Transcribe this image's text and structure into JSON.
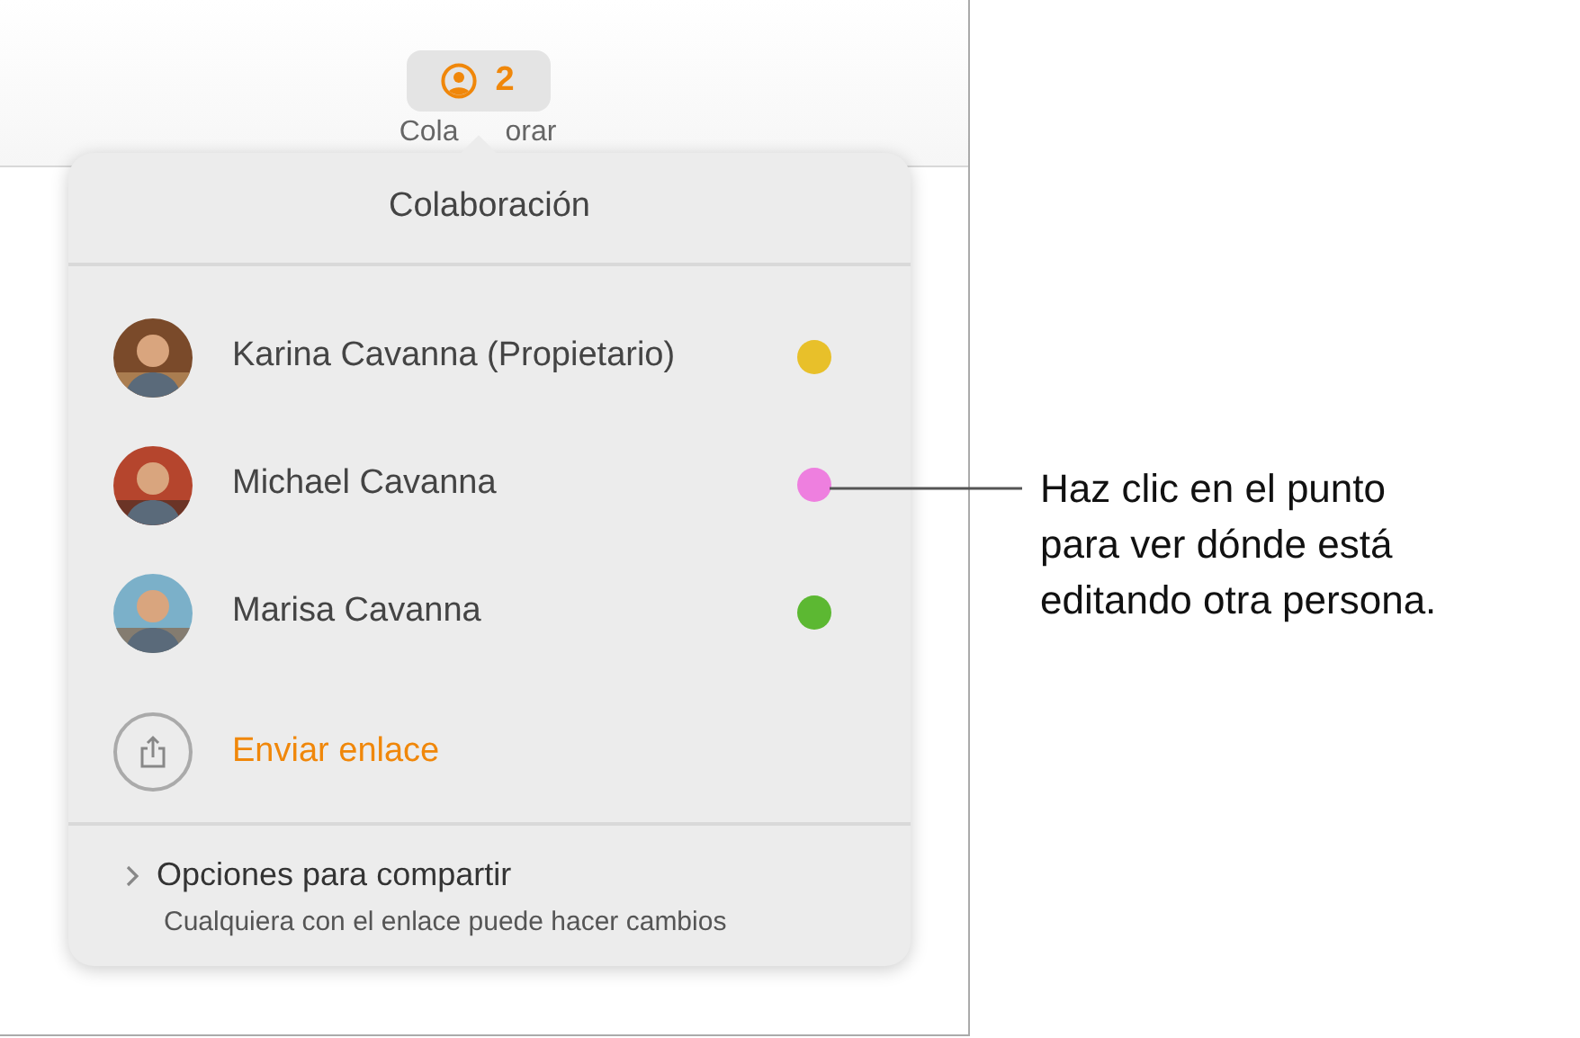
{
  "toolbar": {
    "count": "2",
    "label_parts": [
      "Cola",
      "orar"
    ]
  },
  "popover": {
    "title": "Colaboración",
    "participants": [
      {
        "name": "Karina Cavanna (Propietario)",
        "color": "#e8c02a"
      },
      {
        "name": "Michael Cavanna",
        "color": "#ee7fdf"
      },
      {
        "name": "Marisa Cavanna",
        "color": "#5cb832"
      }
    ],
    "send_link": "Enviar enlace",
    "options": {
      "expanded": false,
      "title": "Opciones para compartir",
      "subtitle": "Cualquiera con el enlace puede hacer cambios"
    }
  },
  "callout": {
    "lines": [
      "Haz clic en el punto",
      "para ver dónde está",
      "editando otra persona."
    ]
  }
}
